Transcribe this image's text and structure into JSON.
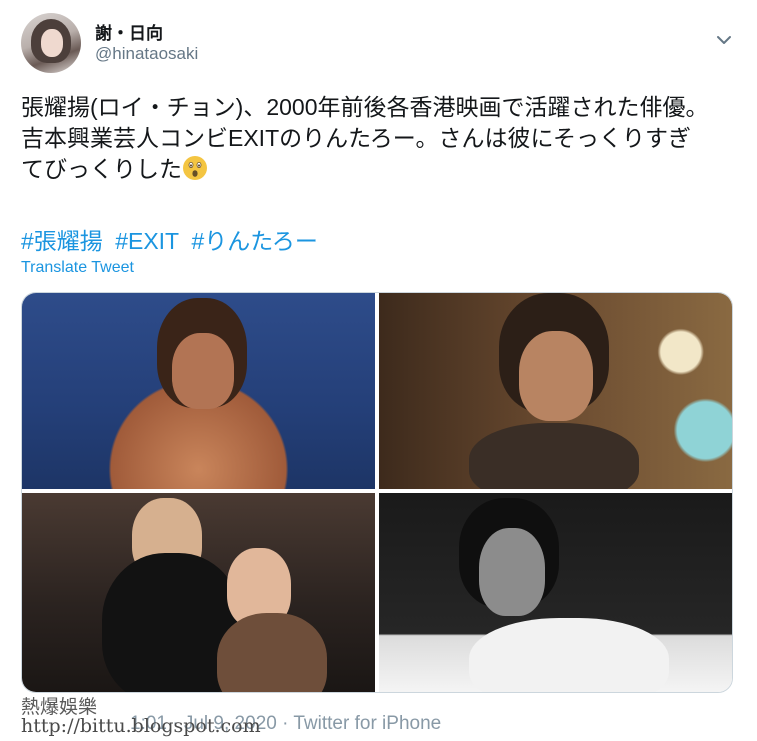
{
  "author": {
    "display_name": "謝・日向",
    "handle": "@hinataosaki"
  },
  "icons": {
    "caret": "chevron-down-icon",
    "emoji": "astonished-face-icon"
  },
  "tweet": {
    "line1": "張耀揚(ロイ・チョン)、2000年前後各香港映画で活躍された俳優。",
    "line2": "吉本興業芸人コンビEXITのりんたろー。さんは彼にそっくりすぎ",
    "line3": "てびっくりした",
    "emoji": "😲",
    "hashtags": [
      "#張耀揚",
      "#EXIT",
      "#りんたろー"
    ],
    "translate_label": "Translate Tweet"
  },
  "watermark": {
    "line1": "熱爆娛樂",
    "line2": "http://bittu.blogspot.com"
  },
  "footer": {
    "meta": "1:01 · Jul 9, 2020 · Twitter for iPhone"
  },
  "colors": {
    "link": "#1b95e0",
    "text": "#14171a",
    "muted": "#657786"
  }
}
